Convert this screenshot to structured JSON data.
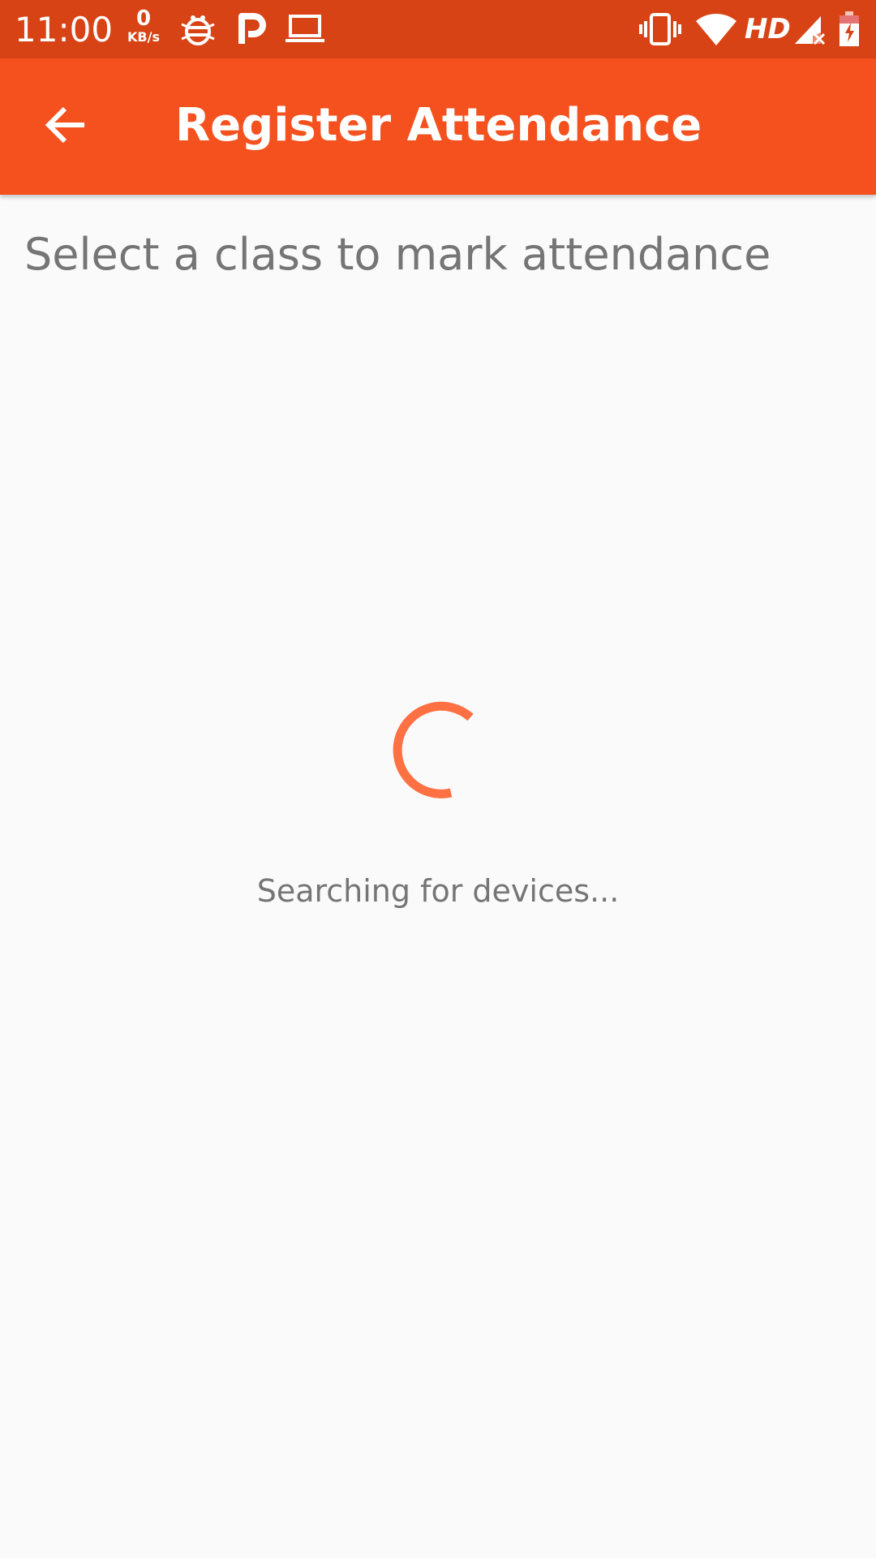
{
  "status_bar": {
    "time": "11:00",
    "net_speed_value": "0",
    "net_speed_unit": "KB/s",
    "network_label": "HD",
    "background_color": "#d84315",
    "left_icons": [
      "bug-report-icon",
      "p-app-icon",
      "laptop-icon"
    ],
    "right_icons": [
      "vibrate-icon",
      "wifi-icon",
      "signal-no-service-icon",
      "battery-charging-icon"
    ]
  },
  "app_bar": {
    "title": "Register Attendance",
    "back_icon": "arrow-back-icon",
    "background_color": "#f4511e"
  },
  "main": {
    "instruction": "Select a class to mark attendance",
    "status_text": "Searching for devices...",
    "spinner_color": "#ff7043"
  }
}
